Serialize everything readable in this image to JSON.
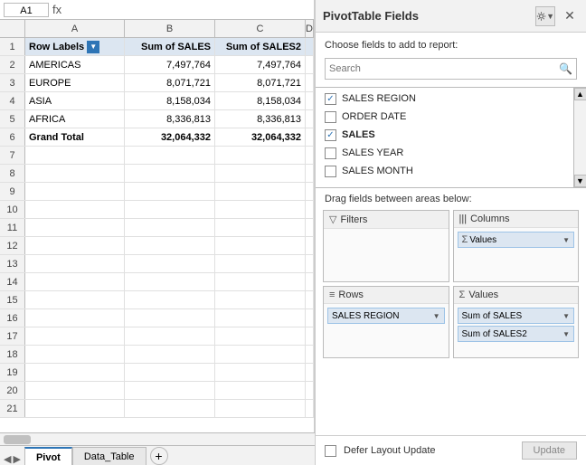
{
  "spreadsheet": {
    "name_box": "A1",
    "columns": {
      "headers": [
        "",
        "A",
        "B",
        "C",
        "D"
      ]
    },
    "rows": [
      {
        "num": "1",
        "type": "header",
        "cells": [
          "Row Labels",
          "Sum of SALES",
          "Sum of SALES2"
        ]
      },
      {
        "num": "2",
        "type": "data",
        "cells": [
          "AMERICAS",
          "7,497,764",
          "7,497,764"
        ]
      },
      {
        "num": "3",
        "type": "data",
        "cells": [
          "EUROPE",
          "8,071,721",
          "8,071,721"
        ]
      },
      {
        "num": "4",
        "type": "data",
        "cells": [
          "ASIA",
          "8,158,034",
          "8,158,034"
        ]
      },
      {
        "num": "5",
        "type": "data",
        "cells": [
          "AFRICA",
          "8,336,813",
          "8,336,813"
        ]
      },
      {
        "num": "6",
        "type": "grand",
        "cells": [
          "Grand Total",
          "32,064,332",
          "32,064,332"
        ]
      },
      {
        "num": "7",
        "type": "empty",
        "cells": [
          "",
          "",
          ""
        ]
      },
      {
        "num": "8",
        "type": "empty",
        "cells": [
          "",
          "",
          ""
        ]
      },
      {
        "num": "9",
        "type": "empty",
        "cells": [
          "",
          "",
          ""
        ]
      },
      {
        "num": "10",
        "type": "empty",
        "cells": [
          "",
          "",
          ""
        ]
      },
      {
        "num": "11",
        "type": "empty",
        "cells": [
          "",
          "",
          ""
        ]
      },
      {
        "num": "12",
        "type": "empty",
        "cells": [
          "",
          "",
          ""
        ]
      },
      {
        "num": "13",
        "type": "empty",
        "cells": [
          "",
          "",
          ""
        ]
      },
      {
        "num": "14",
        "type": "empty",
        "cells": [
          "",
          "",
          ""
        ]
      },
      {
        "num": "15",
        "type": "empty",
        "cells": [
          "",
          "",
          ""
        ]
      },
      {
        "num": "16",
        "type": "empty",
        "cells": [
          "",
          "",
          ""
        ]
      },
      {
        "num": "17",
        "type": "empty",
        "cells": [
          "",
          "",
          ""
        ]
      },
      {
        "num": "18",
        "type": "empty",
        "cells": [
          "",
          "",
          ""
        ]
      },
      {
        "num": "19",
        "type": "empty",
        "cells": [
          "",
          "",
          ""
        ]
      },
      {
        "num": "20",
        "type": "empty",
        "cells": [
          "",
          "",
          ""
        ]
      },
      {
        "num": "21",
        "type": "empty",
        "cells": [
          "",
          "",
          ""
        ]
      }
    ],
    "tabs": [
      {
        "label": "Pivot",
        "active": true
      },
      {
        "label": "Data_Table",
        "active": false
      }
    ]
  },
  "pivot_panel": {
    "title": "PivotTable Fields",
    "choose_text": "Choose fields to add to report:",
    "search_placeholder": "Search",
    "fields": [
      {
        "name": "SALES REGION",
        "checked": true,
        "bold": false
      },
      {
        "name": "ORDER DATE",
        "checked": false,
        "bold": false
      },
      {
        "name": "SALES",
        "checked": true,
        "bold": true
      },
      {
        "name": "SALES YEAR",
        "checked": false,
        "bold": false
      },
      {
        "name": "SALES MONTH",
        "checked": false,
        "bold": false
      }
    ],
    "drag_instruction": "Drag fields between areas below:",
    "areas": {
      "filters": {
        "label": "Filters",
        "icon": "filter",
        "pills": []
      },
      "columns": {
        "label": "Columns",
        "icon": "columns",
        "pills": [
          {
            "text": "Values",
            "has_arrow": true
          }
        ]
      },
      "rows": {
        "label": "Rows",
        "icon": "rows",
        "pills": [
          {
            "text": "SALES REGION",
            "has_arrow": true
          }
        ]
      },
      "values": {
        "label": "Values",
        "icon": "sigma",
        "pills": [
          {
            "text": "Sum of SALES",
            "has_arrow": true
          },
          {
            "text": "Sum of SALES2",
            "has_arrow": true
          }
        ]
      }
    },
    "footer": {
      "defer_label": "Defer Layout Update",
      "update_btn": "Update"
    }
  }
}
